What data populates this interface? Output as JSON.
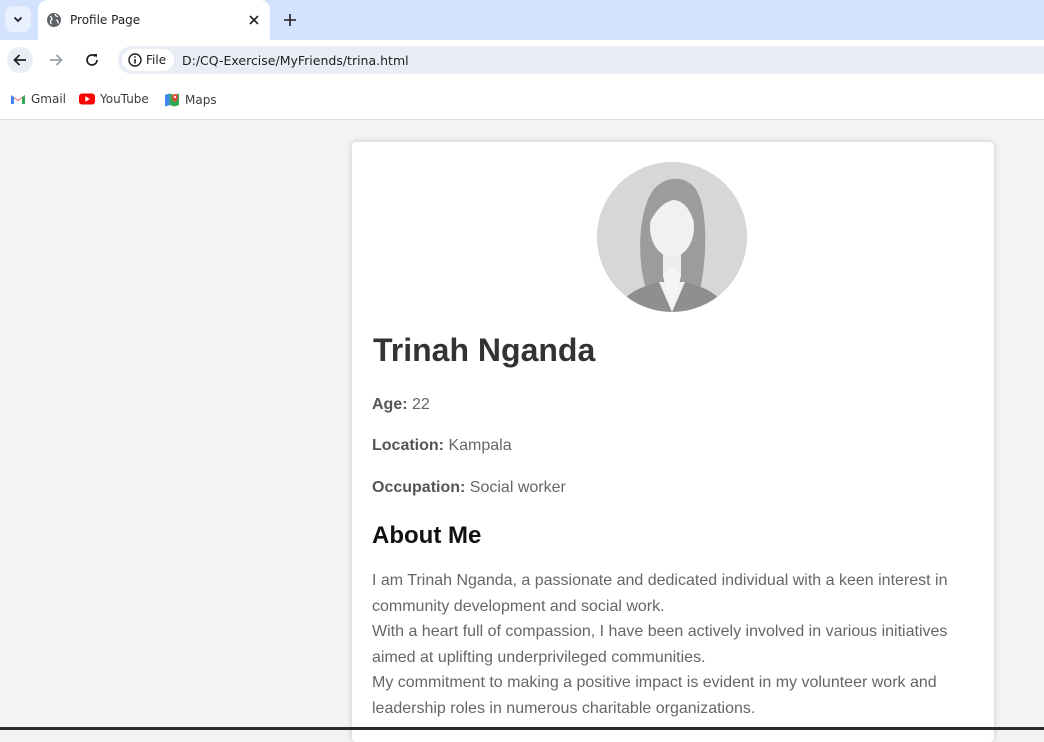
{
  "browser": {
    "tab_title": "Profile Page",
    "chip_label": "File",
    "url": "D:/CQ-Exercise/MyFriends/trina.html",
    "bookmarks": [
      {
        "label": "Gmail",
        "icon": "gmail-icon"
      },
      {
        "label": "YouTube",
        "icon": "youtube-icon"
      },
      {
        "label": "Maps",
        "icon": "maps-icon"
      }
    ]
  },
  "profile": {
    "name": "Trinah Nganda",
    "age_label": "Age:",
    "age": "22",
    "location_label": "Location:",
    "location": "Kampala",
    "occupation_label": "Occupation:",
    "occupation": "Social worker",
    "about_heading": "About Me",
    "about_lines": [
      "I am Trinah Nganda, a passionate and dedicated individual with a keen interest in",
      "community development and social work.",
      "With a heart full of compassion, I have been actively involved in various initiatives",
      "aimed at uplifting underprivileged communities.",
      "My commitment to making a positive impact is evident in my volunteer work and",
      "leadership roles in numerous charitable organizations."
    ]
  },
  "colors": {
    "tabstrip": "#d3e3fd",
    "page_background": "#f3f3f3",
    "card": "#ffffff",
    "name_text": "#333333",
    "body_text": "#666666"
  }
}
